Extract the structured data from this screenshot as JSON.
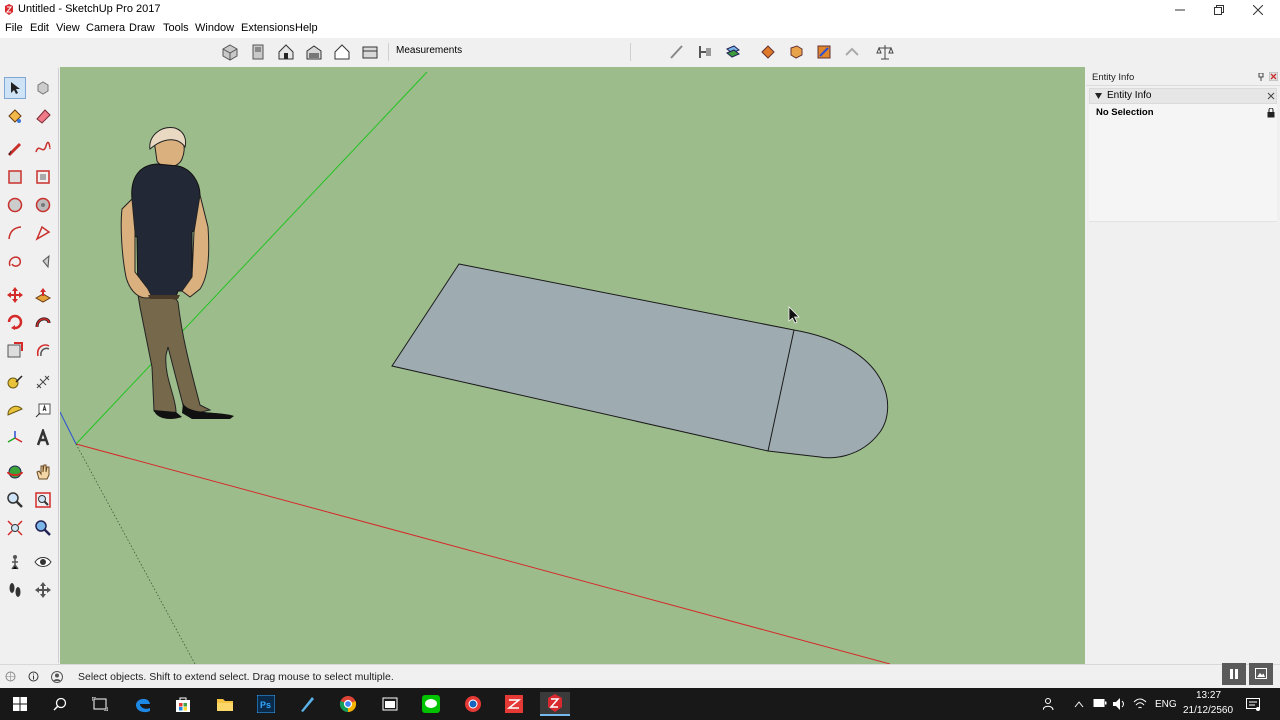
{
  "window": {
    "title": "Untitled - SketchUp Pro 2017"
  },
  "menu": {
    "items": [
      "File",
      "Edit",
      "View",
      "Camera",
      "Draw",
      "Tools",
      "Window",
      "Extensions",
      "Help"
    ]
  },
  "toolbar": {
    "measurements_label": "Measurements"
  },
  "tray": {
    "title": "Entity Info",
    "panel_title": "Entity Info",
    "selection_text": "No Selection"
  },
  "status": {
    "text": "Select objects. Shift to extend select. Drag mouse to select multiple."
  },
  "taskbar": {
    "language": "ENG",
    "time": "13:27",
    "date": "21/12/2560"
  },
  "colors": {
    "viewport_background": "#9dbc8b",
    "shape_face": "#9eabb1",
    "red_axis": "#d42a2a",
    "green_axis": "#22c422",
    "taskbar": "#181818"
  }
}
